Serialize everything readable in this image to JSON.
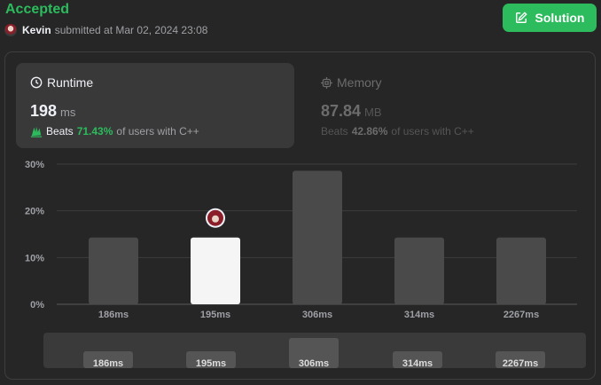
{
  "header": {
    "status": "Accepted",
    "user": "Kevin",
    "submitted_text": "submitted at Mar 02, 2024 23:08",
    "solution_label": "Solution"
  },
  "runtime": {
    "title": "Runtime",
    "value": "198",
    "unit": "ms",
    "beats_label": "Beats",
    "beats_pct": "71.43%",
    "beats_suffix": "of users with C++"
  },
  "memory": {
    "title": "Memory",
    "value": "87.84",
    "unit": "MB",
    "beats_label": "Beats",
    "beats_pct": "42.86%",
    "beats_suffix": "of users with C++"
  },
  "colors": {
    "accent": "#2cbb5d",
    "bar": "#4a4a4a",
    "bar_active": "#f5f5f5"
  },
  "chart_data": {
    "type": "bar",
    "categories": [
      "186ms",
      "195ms",
      "306ms",
      "314ms",
      "2267ms"
    ],
    "values": [
      14.29,
      14.29,
      28.57,
      14.29,
      14.29
    ],
    "highlight_index": 1,
    "yticks": [
      "0%",
      "10%",
      "20%",
      "30%"
    ],
    "ylim": [
      0,
      30
    ],
    "grid": true
  },
  "mini_chart": {
    "categories": [
      "186ms",
      "195ms",
      "306ms",
      "314ms",
      "2267ms"
    ],
    "values": [
      14.29,
      14.29,
      28.57,
      14.29,
      14.29
    ]
  }
}
